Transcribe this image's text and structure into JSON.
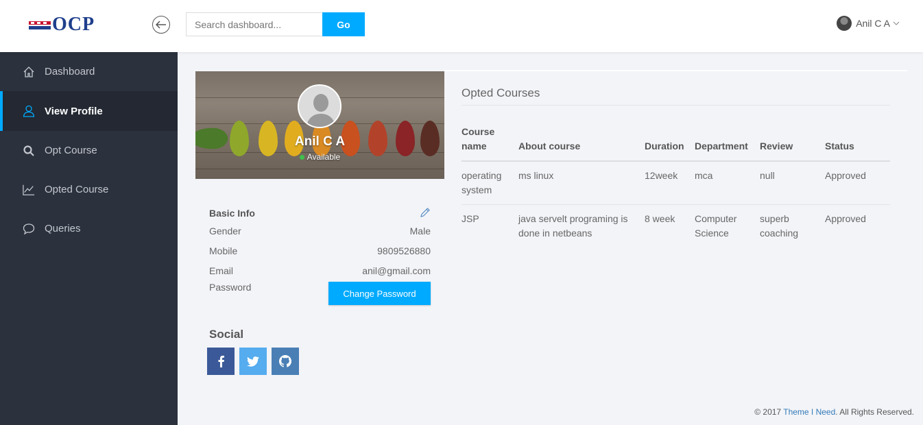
{
  "header": {
    "logo_text": "OCP",
    "search_placeholder": "Search dashboard...",
    "search_button": "Go",
    "user_name": "Anil C A"
  },
  "sidebar": {
    "items": [
      {
        "label": "Dashboard",
        "icon": "home-icon",
        "active": false
      },
      {
        "label": "View Profile",
        "icon": "user-icon",
        "active": true
      },
      {
        "label": "Opt Course",
        "icon": "search-icon",
        "active": false
      },
      {
        "label": "Opted Course",
        "icon": "line-chart-icon",
        "active": false
      },
      {
        "label": "Queries",
        "icon": "chat-bubble-icon",
        "active": false
      }
    ]
  },
  "profile": {
    "name": "Anil C A",
    "status": "Available"
  },
  "basic_info": {
    "title": "Basic Info",
    "rows": [
      {
        "label": "Gender",
        "value": "Male"
      },
      {
        "label": "Mobile",
        "value": "9809526880"
      },
      {
        "label": "Email",
        "value": "anil@gmail.com"
      }
    ],
    "password_label": "Password",
    "change_password_button": "Change Password"
  },
  "social": {
    "title": "Social",
    "buttons": [
      {
        "icon": "facebook-icon",
        "color": "#3b5998"
      },
      {
        "icon": "twitter-icon",
        "color": "#55acee"
      },
      {
        "icon": "github-icon",
        "color": "#4a7fb5"
      }
    ]
  },
  "courses": {
    "title": "Opted Courses",
    "columns": [
      "Course name",
      "About course",
      "Duration",
      "Department",
      "Review",
      "Status"
    ],
    "rows": [
      [
        "operating system",
        "ms linux",
        "12week",
        "mca",
        "null",
        "Approved"
      ],
      [
        "JSP",
        "java servelt programing is done in netbeans",
        "8 week",
        "Computer Science",
        "superb coaching",
        "Approved"
      ]
    ]
  },
  "footer": {
    "prefix": "© 2017 ",
    "link": "Theme I Need",
    "suffix": ". All Rights Reserved."
  },
  "colors": {
    "accent": "#00aaff",
    "sidebar_bg": "#2b313d",
    "status_online": "#3ec14b"
  }
}
